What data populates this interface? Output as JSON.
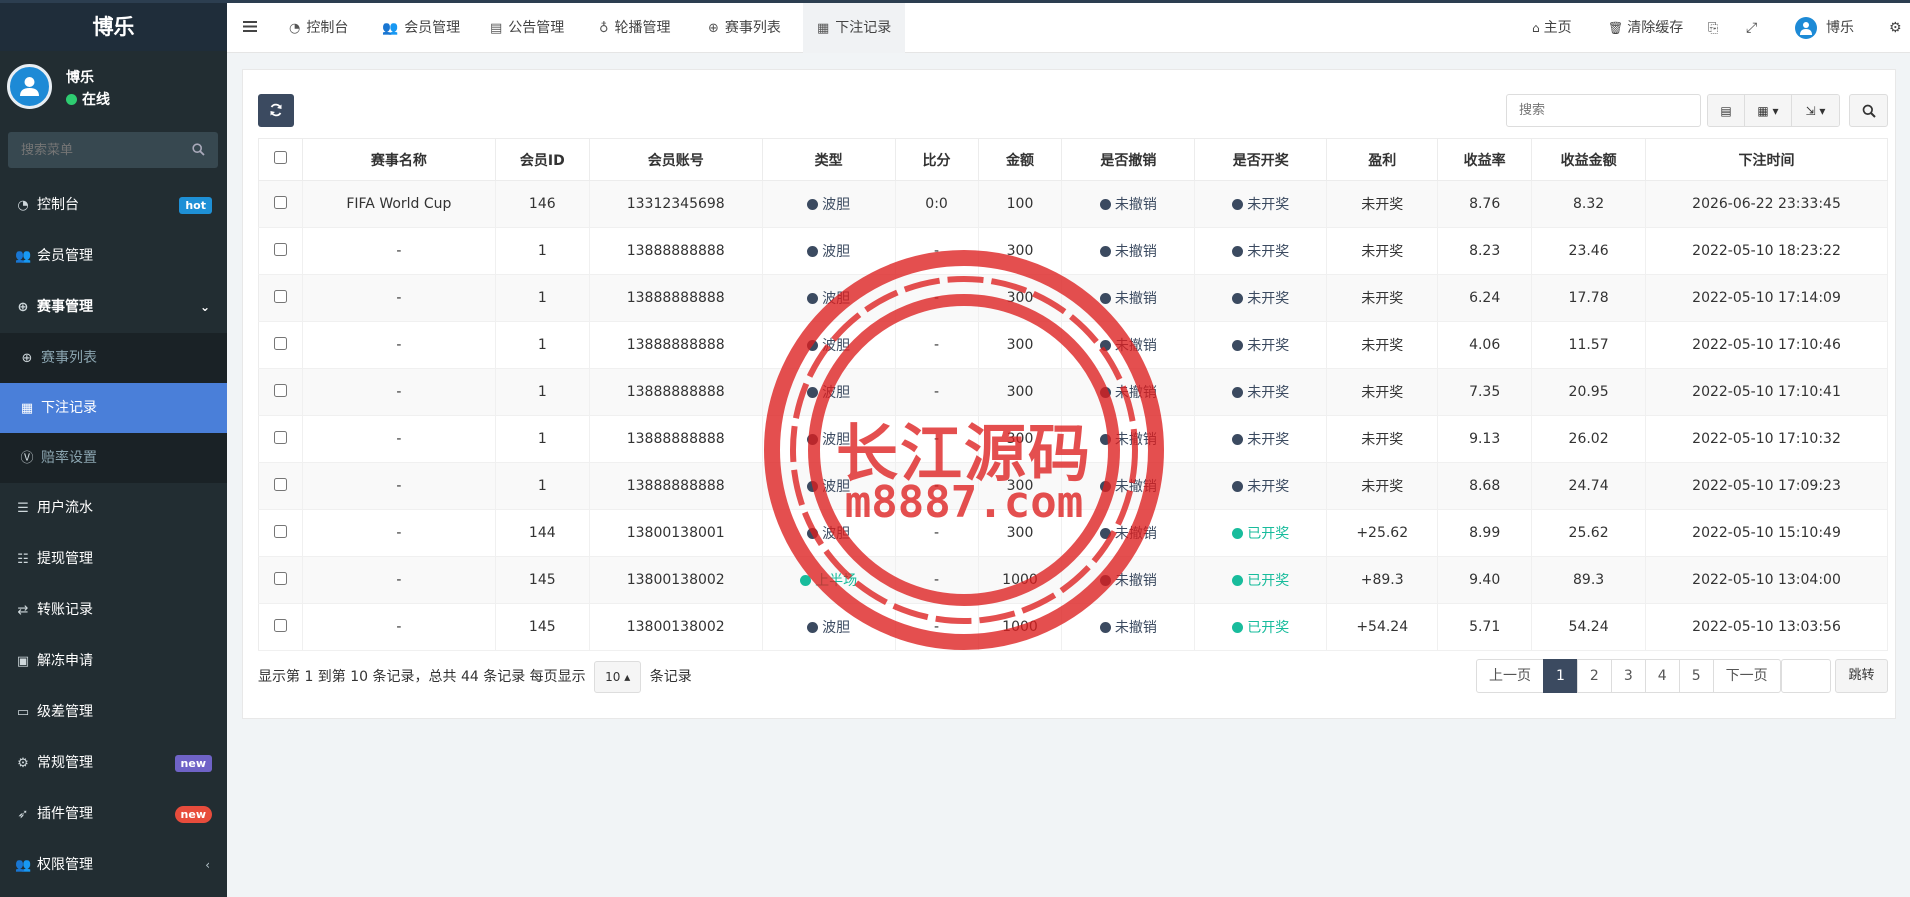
{
  "app": {
    "title": "博乐"
  },
  "user": {
    "name": "博乐",
    "status": "在线"
  },
  "sidebar": {
    "search_placeholder": "搜索菜单",
    "items": [
      {
        "label": "控制台",
        "badge": "hot"
      },
      {
        "label": "会员管理"
      },
      {
        "label": "赛事管理"
      },
      {
        "label": "赛事列表"
      },
      {
        "label": "下注记录"
      },
      {
        "label": "赔率设置"
      },
      {
        "label": "用户流水"
      },
      {
        "label": "提现管理"
      },
      {
        "label": "转账记录"
      },
      {
        "label": "解冻申请"
      },
      {
        "label": "级差管理"
      },
      {
        "label": "常规管理",
        "badge": "new"
      },
      {
        "label": "插件管理",
        "badge": "new"
      },
      {
        "label": "权限管理"
      }
    ]
  },
  "header": {
    "tabs": [
      "控制台",
      "会员管理",
      "公告管理",
      "轮播管理",
      "赛事列表",
      "下注记录"
    ],
    "home": "主页",
    "clear_cache": "清除缓存",
    "user_name": "博乐"
  },
  "toolbar": {
    "search_placeholder": "搜索"
  },
  "table": {
    "columns": [
      "赛事名称",
      "会员ID",
      "会员账号",
      "类型",
      "比分",
      "金额",
      "是否撤销",
      "是否开奖",
      "盈利",
      "收益率",
      "收益金额",
      "下注时间"
    ],
    "rows": [
      [
        "FIFA World Cup",
        "146",
        "13312345698",
        "波胆",
        "0:0",
        "100",
        "未撤销",
        "未开奖",
        "未开奖",
        "8.76",
        "8.32",
        "2026-06-22 23:33:45"
      ],
      [
        "-",
        "1",
        "13888888888",
        "波胆",
        "-",
        "300",
        "未撤销",
        "未开奖",
        "未开奖",
        "8.23",
        "23.46",
        "2022-05-10 18:23:22"
      ],
      [
        "-",
        "1",
        "13888888888",
        "波胆",
        "-",
        "300",
        "未撤销",
        "未开奖",
        "未开奖",
        "6.24",
        "17.78",
        "2022-05-10 17:14:09"
      ],
      [
        "-",
        "1",
        "13888888888",
        "波胆",
        "-",
        "300",
        "未撤销",
        "未开奖",
        "未开奖",
        "4.06",
        "11.57",
        "2022-05-10 17:10:46"
      ],
      [
        "-",
        "1",
        "13888888888",
        "波胆",
        "-",
        "300",
        "未撤销",
        "未开奖",
        "未开奖",
        "7.35",
        "20.95",
        "2022-05-10 17:10:41"
      ],
      [
        "-",
        "1",
        "13888888888",
        "波胆",
        "-",
        "300",
        "未撤销",
        "未开奖",
        "未开奖",
        "9.13",
        "26.02",
        "2022-05-10 17:10:32"
      ],
      [
        "-",
        "1",
        "13888888888",
        "波胆",
        "-",
        "300",
        "未撤销",
        "未开奖",
        "未开奖",
        "8.68",
        "24.74",
        "2022-05-10 17:09:23"
      ],
      [
        "-",
        "144",
        "13800138001",
        "波胆",
        "-",
        "300",
        "未撤销",
        "已开奖",
        "+25.62",
        "8.99",
        "25.62",
        "2022-05-10 15:10:49"
      ],
      [
        "-",
        "145",
        "13800138002",
        "上半场",
        "-",
        "1000",
        "未撤销",
        "已开奖",
        "+89.3",
        "9.40",
        "89.3",
        "2022-05-10 13:04:00"
      ],
      [
        "-",
        "145",
        "13800138002",
        "波胆",
        "-",
        "1000",
        "未撤销",
        "已开奖",
        "+54.24",
        "5.71",
        "54.24",
        "2022-05-10 13:03:56"
      ]
    ]
  },
  "pagination": {
    "info_prefix": "显示第 1 到第 10 条记录，总共 44 条记录 每页显示",
    "page_size": "10",
    "info_suffix": "条记录",
    "prev": "上一页",
    "pages": [
      "1",
      "2",
      "3",
      "4",
      "5"
    ],
    "next": "下一页",
    "jump": "跳转"
  },
  "watermark": {
    "line1": "长江源码",
    "line2": "m8887.com"
  }
}
